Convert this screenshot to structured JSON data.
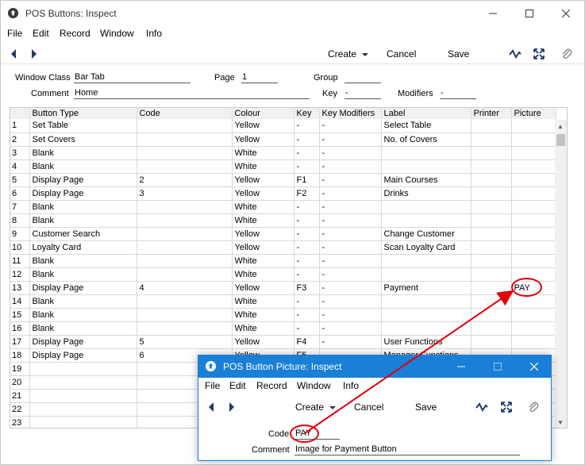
{
  "main": {
    "title": "POS Buttons: Inspect",
    "menu": [
      "File",
      "Edit",
      "Record",
      "Window",
      "Info"
    ],
    "toolbar": {
      "create": "Create",
      "cancel": "Cancel",
      "save": "Save"
    },
    "header": {
      "window_class_label": "Window Class",
      "window_class_value": "Bar Tab",
      "page_label": "Page",
      "page_value": "1",
      "group_label": "Group",
      "group_value": "",
      "comment_label": "Comment",
      "comment_value": "Home",
      "key_label": "Key",
      "key_value": "-",
      "modifiers_label": "Modifiers",
      "modifiers_value": "-"
    },
    "columns": [
      "",
      "Button Type",
      "Code",
      "Colour",
      "Key",
      "Key Modifiers",
      "Label",
      "Printer",
      "Picture"
    ],
    "rows": [
      [
        "1",
        "Set Table",
        "",
        "Yellow",
        "-",
        "-",
        "Select Table",
        "",
        ""
      ],
      [
        "2",
        "Set Covers",
        "",
        "Yellow",
        "-",
        "-",
        "No. of  Covers",
        "",
        ""
      ],
      [
        "3",
        "Blank",
        "",
        "White",
        "-",
        "-",
        "",
        "",
        ""
      ],
      [
        "4",
        "Blank",
        "",
        "White",
        "-",
        "-",
        "",
        "",
        ""
      ],
      [
        "5",
        "Display Page",
        "2",
        "Yellow",
        "F1",
        "-",
        "Main Courses",
        "",
        ""
      ],
      [
        "6",
        "Display Page",
        "3",
        "Yellow",
        "F2",
        "-",
        "Drinks",
        "",
        ""
      ],
      [
        "7",
        "Blank",
        "",
        "White",
        "-",
        "-",
        "",
        "",
        ""
      ],
      [
        "8",
        "Blank",
        "",
        "White",
        "-",
        "-",
        "",
        "",
        ""
      ],
      [
        "9",
        "Customer Search",
        "",
        "Yellow",
        "-",
        "-",
        "Change Customer",
        "",
        ""
      ],
      [
        "10",
        "Loyalty Card",
        "",
        "Yellow",
        "-",
        "-",
        "Scan Loyalty Card",
        "",
        ""
      ],
      [
        "11",
        "Blank",
        "",
        "White",
        "-",
        "-",
        "",
        "",
        ""
      ],
      [
        "12",
        "Blank",
        "",
        "White",
        "-",
        "-",
        "",
        "",
        ""
      ],
      [
        "13",
        "Display Page",
        "4",
        "Yellow",
        "F3",
        "-",
        "Payment",
        "",
        "PAY"
      ],
      [
        "14",
        "Blank",
        "",
        "White",
        "-",
        "-",
        "",
        "",
        ""
      ],
      [
        "15",
        "Blank",
        "",
        "White",
        "-",
        "-",
        "",
        "",
        ""
      ],
      [
        "16",
        "Blank",
        "",
        "White",
        "-",
        "-",
        "",
        "",
        ""
      ],
      [
        "17",
        "Display Page",
        "5",
        "Yellow",
        "F4",
        "-",
        "User Functions",
        "",
        ""
      ],
      [
        "18",
        "Display Page",
        "6",
        "Yellow",
        "F5",
        "-",
        "Manager Functions",
        "",
        ""
      ],
      [
        "19",
        "",
        "",
        "",
        "",
        "",
        "",
        "",
        ""
      ],
      [
        "20",
        "",
        "",
        "",
        "",
        "",
        "",
        "",
        ""
      ],
      [
        "21",
        "",
        "",
        "",
        "",
        "",
        "",
        "",
        ""
      ],
      [
        "22",
        "",
        "",
        "",
        "",
        "",
        "",
        "",
        ""
      ],
      [
        "23",
        "",
        "",
        "",
        "",
        "",
        "",
        "",
        ""
      ]
    ]
  },
  "popup": {
    "title": "POS Button Picture: Inspect",
    "menu": [
      "File",
      "Edit",
      "Record",
      "Window",
      "Info"
    ],
    "toolbar": {
      "create": "Create",
      "cancel": "Cancel",
      "save": "Save"
    },
    "code_label": "Code",
    "code_value": "PAY",
    "comment_label": "Comment",
    "comment_value": "Image for Payment Button"
  },
  "colors": {
    "accent": "#1a7fd6",
    "annotation": "#e0000b"
  },
  "icons": [
    "app-icon",
    "minimize-icon",
    "maximize-icon",
    "close-icon",
    "back-arrow-icon",
    "forward-arrow-icon",
    "dropdown-arrow-icon",
    "activity-icon",
    "expand-icon",
    "paperclip-icon"
  ]
}
